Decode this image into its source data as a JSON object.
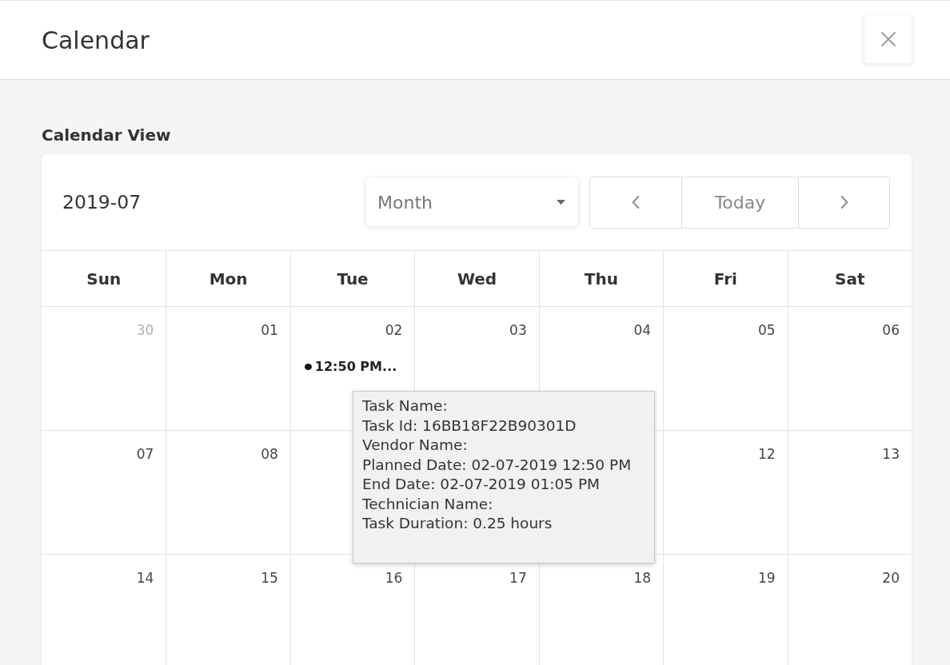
{
  "modal": {
    "title": "Calendar"
  },
  "section": {
    "label": "Calendar View"
  },
  "toolbar": {
    "period": "2019-07",
    "view_select": {
      "value": "Month"
    },
    "nav": {
      "today": "Today"
    }
  },
  "weekdays": [
    "Sun",
    "Mon",
    "Tue",
    "Wed",
    "Thu",
    "Fri",
    "Sat"
  ],
  "weeks": [
    {
      "days": [
        {
          "date": "30",
          "in_month": false
        },
        {
          "date": "01",
          "in_month": true
        },
        {
          "date": "02",
          "in_month": true,
          "events": [
            {
              "time": "12:50 PM..."
            }
          ]
        },
        {
          "date": "03",
          "in_month": true
        },
        {
          "date": "04",
          "in_month": true
        },
        {
          "date": "05",
          "in_month": true
        },
        {
          "date": "06",
          "in_month": true
        }
      ]
    },
    {
      "days": [
        {
          "date": "07",
          "in_month": true
        },
        {
          "date": "08",
          "in_month": true
        }
      ],
      "trailing_days": [
        {
          "date": "12",
          "in_month": true
        },
        {
          "date": "13",
          "in_month": true
        }
      ]
    },
    {
      "days": [
        {
          "date": "14",
          "in_month": true
        },
        {
          "date": "15",
          "in_month": true
        },
        {
          "date": "16",
          "in_month": true
        },
        {
          "date": "17",
          "in_month": true
        },
        {
          "date": "18",
          "in_month": true
        },
        {
          "date": "19",
          "in_month": true
        },
        {
          "date": "20",
          "in_month": true
        }
      ]
    }
  ],
  "tooltip": {
    "lines": [
      "Task Name:",
      "Task Id: 16BB18F22B90301D",
      "Vendor Name:",
      "Planned Date: 02-07-2019 12:50 PM",
      "End Date: 02-07-2019 01:05 PM",
      "Technician Name:",
      "Task Duration: 0.25 hours"
    ]
  }
}
